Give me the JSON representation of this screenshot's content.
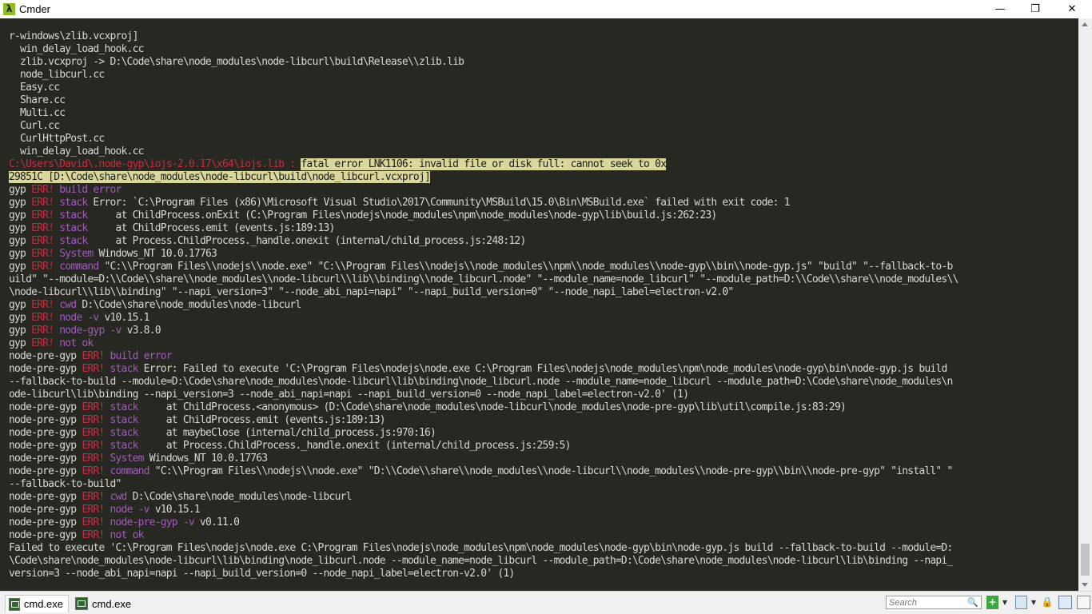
{
  "window": {
    "title": "Cmder",
    "app_icon_glyph": "λ",
    "minimize_glyph": "—",
    "maximize_glyph": "❐",
    "close_glyph": "✕"
  },
  "console": {
    "line_01": "r-windows\\zlib.vcxproj]",
    "line_02": "  win_delay_load_hook.cc",
    "line_03": "  zlib.vcxproj -> D:\\Code\\share\\node_modules\\node-libcurl\\build\\Release\\\\zlib.lib",
    "line_04": "  node_libcurl.cc",
    "line_05": "  Easy.cc",
    "line_06": "  Share.cc",
    "line_07": "  Multi.cc",
    "line_08": "  Curl.cc",
    "line_09": "  CurlHttpPost.cc",
    "line_10": "  win_delay_load_hook.cc",
    "line_11_path": "C:\\Users\\David\\.node-gyp\\iojs-2.0.17\\x64\\iojs.lib : ",
    "line_11_selected": "fatal error LNK1106: invalid file or disk full: cannot seek to 0x",
    "line_12_selected": "29851C [D:\\Code\\share\\node_modules\\node-libcurl\\build\\node_libcurl.vcxproj]",
    "gyp_prefix": "gyp",
    "npg_prefix": "node-pre-gyp",
    "err_label": "ERR!",
    "gyp_lines": [
      {
        "tag": "build error",
        "rest": ""
      },
      {
        "tag": "stack",
        "rest": " Error: `C:\\Program Files (x86)\\Microsoft Visual Studio\\2017\\Community\\MSBuild\\15.0\\Bin\\MSBuild.exe` failed with exit code: 1"
      },
      {
        "tag": "stack",
        "rest": "     at ChildProcess.onExit (C:\\Program Files\\nodejs\\node_modules\\npm\\node_modules\\node-gyp\\lib\\build.js:262:23)"
      },
      {
        "tag": "stack",
        "rest": "     at ChildProcess.emit (events.js:189:13)"
      },
      {
        "tag": "stack",
        "rest": "     at Process.ChildProcess._handle.onexit (internal/child_process.js:248:12)"
      },
      {
        "tag": "System",
        "rest": " Windows_NT 10.0.17763"
      },
      {
        "tag": "command",
        "rest": " \"C:\\\\Program Files\\\\nodejs\\\\node.exe\" \"C:\\\\Program Files\\\\nodejs\\\\node_modules\\\\npm\\\\node_modules\\\\node-gyp\\\\bin\\\\node-gyp.js\" \"build\" \"--fallback-to-b"
      }
    ],
    "wrap_a1": "uild\" \"--module=D:\\\\Code\\\\share\\\\node_modules\\\\node-libcurl\\\\lib\\\\binding\\\\node_libcurl.node\" \"--module_name=node_libcurl\" \"--module_path=D:\\\\Code\\\\share\\\\node_modules\\\\",
    "wrap_a2": "\\node-libcurl\\\\lib\\\\binding\" \"--napi_version=3\" \"--node_abi_napi=napi\" \"--napi_build_version=0\" \"--node_napi_label=electron-v2.0\"",
    "gyp_lines_2": [
      {
        "tag": "cwd",
        "rest": " D:\\Code\\share\\node_modules\\node-libcurl"
      },
      {
        "tag": "node -v",
        "rest": " v10.15.1"
      },
      {
        "tag": "node-gyp -v",
        "rest": " v3.8.0"
      },
      {
        "tag": "not ok",
        "rest": ""
      }
    ],
    "npg_lines": [
      {
        "tag": "build error",
        "rest": ""
      },
      {
        "tag": "stack",
        "rest": " Error: Failed to execute 'C:\\Program Files\\nodejs\\node.exe C:\\Program Files\\nodejs\\node_modules\\npm\\node_modules\\node-gyp\\bin\\node-gyp.js build"
      }
    ],
    "wrap_b1": "--fallback-to-build --module=D:\\Code\\share\\node_modules\\node-libcurl\\lib\\binding\\node_libcurl.node --module_name=node_libcurl --module_path=D:\\Code\\share\\node_modules\\n",
    "wrap_b2": "ode-libcurl\\lib\\binding --napi_version=3 --node_abi_napi=napi --napi_build_version=0 --node_napi_label=electron-v2.0' (1)",
    "npg_lines_2": [
      {
        "tag": "stack",
        "rest": "     at ChildProcess.<anonymous> (D:\\Code\\share\\node_modules\\node-libcurl\\node_modules\\node-pre-gyp\\lib\\util\\compile.js:83:29)"
      },
      {
        "tag": "stack",
        "rest": "     at ChildProcess.emit (events.js:189:13)"
      },
      {
        "tag": "stack",
        "rest": "     at maybeClose (internal/child_process.js:970:16)"
      },
      {
        "tag": "stack",
        "rest": "     at Process.ChildProcess._handle.onexit (internal/child_process.js:259:5)"
      },
      {
        "tag": "System",
        "rest": " Windows_NT 10.0.17763"
      },
      {
        "tag": "command",
        "rest": " \"C:\\\\Program Files\\\\nodejs\\\\node.exe\" \"D:\\\\Code\\\\share\\\\node_modules\\\\node-libcurl\\\\node_modules\\\\node-pre-gyp\\\\bin\\\\node-pre-gyp\" \"install\" \""
      }
    ],
    "wrap_c1": "--fallback-to-build\"",
    "npg_lines_3": [
      {
        "tag": "cwd",
        "rest": " D:\\Code\\share\\node_modules\\node-libcurl"
      },
      {
        "tag": "node -v",
        "rest": " v10.15.1"
      },
      {
        "tag": "node-pre-gyp -v",
        "rest": " v0.11.0"
      },
      {
        "tag": "not ok",
        "rest": ""
      }
    ],
    "tail_1": "Failed to execute 'C:\\Program Files\\nodejs\\node.exe C:\\Program Files\\nodejs\\node_modules\\npm\\node_modules\\node-gyp\\bin\\node-gyp.js build --fallback-to-build --module=D:",
    "tail_2": "\\Code\\share\\node_modules\\node-libcurl\\lib\\binding\\node_libcurl.node --module_name=node_libcurl --module_path=D:\\Code\\share\\node_modules\\node-libcurl\\lib\\binding --napi_",
    "tail_3": "version=3 --node_abi_napi=napi --napi_build_version=0 --node_napi_label=electron-v2.0' (1)"
  },
  "statusbar": {
    "tabs": [
      {
        "label": "cmd.exe",
        "active": true
      },
      {
        "label": "cmd.exe",
        "active": false
      }
    ],
    "search_placeholder": "Search",
    "search_icon": "🔍",
    "plus_glyph": "+",
    "dropdown_glyph": "▼",
    "lock_glyph": "🔒"
  },
  "colors": {
    "background": "#272822",
    "text": "#d8d8d2",
    "err": "#c62c40",
    "keyword": "#a05bb8",
    "selection": "#d9d89a"
  }
}
